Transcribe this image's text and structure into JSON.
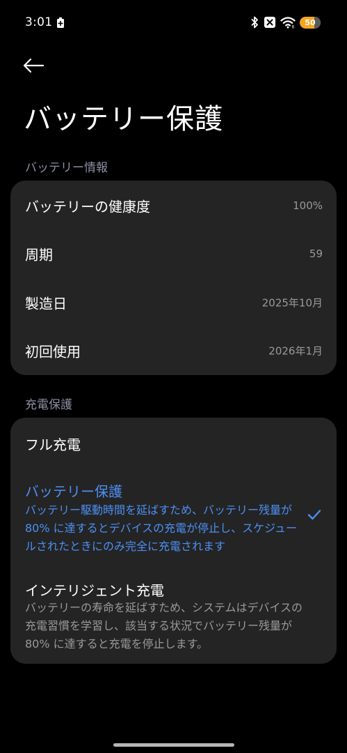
{
  "status_bar": {
    "time": "3:01",
    "battery_level": "50",
    "icons": [
      "battery-saver-icon",
      "bluetooth-icon",
      "no-sim-icon",
      "wifi-icon",
      "battery-icon"
    ]
  },
  "page": {
    "title": "バッテリー保護",
    "back_icon": "back-arrow-icon"
  },
  "battery_info": {
    "header": "バッテリー情報",
    "rows": [
      {
        "label": "バッテリーの健康度",
        "value": "100%"
      },
      {
        "label": "周期",
        "value": "59"
      },
      {
        "label": "製造日",
        "value": "2025年10月"
      },
      {
        "label": "初回使用",
        "value": "2026年1月"
      }
    ]
  },
  "charge_protection": {
    "header": "充電保護",
    "options": [
      {
        "title": "フル充電",
        "description": "",
        "selected": false
      },
      {
        "title": "バッテリー保護",
        "description": "バッテリー駆動時間を延ばすため、バッテリー残量が 80% に達するとデバイスの充電が停止し、スケジュールされたときにのみ完全に充電されます",
        "selected": true
      },
      {
        "title": "インテリジェント充電",
        "description": "バッテリーの寿命を延ばすため、システムはデバイスの充電習慣を学習し、該当する状況でバッテリー残量が 80% に達すると充電を停止します。",
        "selected": false
      }
    ]
  },
  "colors": {
    "background": "#000000",
    "card": "#242424",
    "accent": "#4d8ff5",
    "section_header": "#8a8fa3",
    "secondary_text": "#9a9a9a",
    "battery_pill": "#f5a623"
  }
}
